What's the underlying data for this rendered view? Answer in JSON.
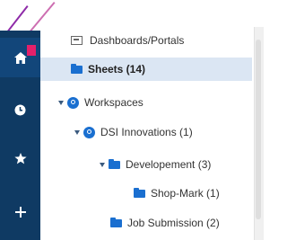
{
  "nav": {
    "items": [
      {
        "icon": "home-icon",
        "active": true
      },
      {
        "icon": "clock-icon",
        "active": false
      },
      {
        "icon": "star-icon",
        "active": false
      },
      {
        "icon": "plus-icon",
        "active": false
      }
    ],
    "accent_color": "#e3206a"
  },
  "tree": {
    "dashboards": {
      "label": "Dashboards/Portals"
    },
    "sheets": {
      "label": "Sheets (14)",
      "selected": true
    },
    "workspaces": {
      "label": "Workspaces",
      "expanded": true
    },
    "dsi": {
      "label": "DSI Innovations (1)",
      "expanded": true
    },
    "development": {
      "label": "Developement (3)",
      "expanded": true
    },
    "shop_mark": {
      "label": "Shop-Mark (1)"
    },
    "job_submission": {
      "label": "Job Submission (2)"
    }
  },
  "colors": {
    "rail_bg": "#0f3a63",
    "selected_row_bg": "#dbe6f3",
    "folder_blue": "#1a6fd0"
  }
}
